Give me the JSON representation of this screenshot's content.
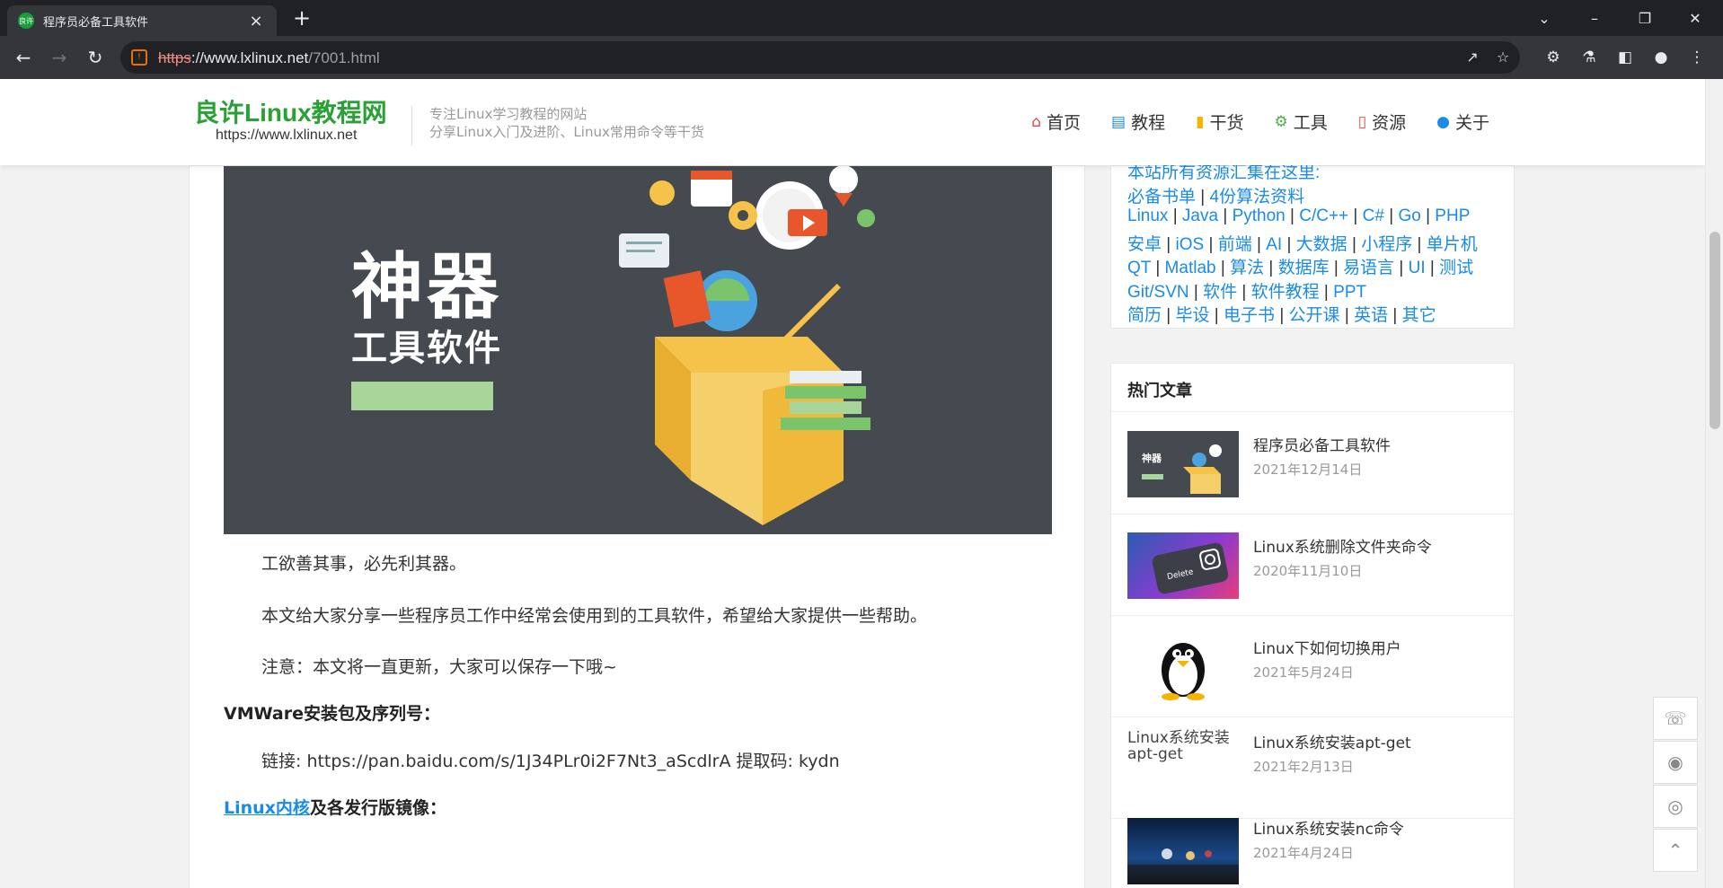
{
  "browser": {
    "tab_title": "程序员必备工具软件",
    "favicon_text": "良许",
    "new_tab": "+",
    "tab_close": "×",
    "url_scheme": "https",
    "url_sep": "://",
    "url_host": "www.lxlinux.net",
    "url_path": "/7001.html",
    "icons": {
      "back": "arrow-left-icon",
      "forward": "arrow-right-icon",
      "reload": "reload-icon",
      "share": "share-icon",
      "star": "star-icon",
      "extensions": "puzzle-icon",
      "labs": "flask-icon",
      "sidepanel": "side-panel-icon",
      "profile": "profile-icon",
      "menu": "kebab-menu-icon"
    }
  },
  "header": {
    "logo_title": "良许Linux教程网",
    "logo_url": "https://www.lxlinux.net",
    "slogan_1": "专注Linux学习教程的网站",
    "slogan_2": "分享Linux入门及进阶、Linux常用命令等干货",
    "nav": [
      {
        "label": "首页",
        "icon": "home-icon",
        "color": "#e8453c"
      },
      {
        "label": "教程",
        "icon": "book-icon",
        "color": "#1a8be8"
      },
      {
        "label": "干货",
        "icon": "bookmark-icon",
        "color": "#f5b400"
      },
      {
        "label": "工具",
        "icon": "cogs-icon",
        "color": "#4caf50"
      },
      {
        "label": "资源",
        "icon": "folder-open-icon",
        "color": "#e8453c"
      },
      {
        "label": "关于",
        "icon": "user-icon",
        "color": "#1a8be8"
      }
    ]
  },
  "article": {
    "hero_big": "神器",
    "hero_sub": "工具软件",
    "p1": "工欲善其事，必先利其器。",
    "p2": "本文给大家分享一些程序员工作中经常会使用到的工具软件，希望给大家提供一些帮助。",
    "p3": "注意：本文将一直更新，大家可以保存一下哦~",
    "h1": "VMWare安装包及序列号：",
    "link_line": "链接: https://pan.baidu.com/s/1J34PLr0i2F7Nt3_aScdlrA  提取码: kydn",
    "h2_link": "Linux内核",
    "h2_rest": "及各发行版镜像："
  },
  "resources": {
    "intro": "本站所有资源汇集在这里:",
    "lines": [
      [
        "必备书单",
        "4份算法资料"
      ],
      [
        "Linux",
        "Java",
        "Python",
        "C/C++",
        "C#",
        "Go",
        "PHP"
      ],
      [
        "安卓",
        "iOS",
        "前端",
        "AI",
        "大数据",
        "小程序",
        "单片机"
      ],
      [
        "QT",
        "Matlab",
        "算法",
        "数据库",
        "易语言",
        "UI",
        "测试"
      ],
      [
        "Git/SVN",
        "软件",
        "软件教程",
        "PPT"
      ],
      [
        "简历",
        "毕设",
        "电子书",
        "公开课",
        "英语",
        "其它"
      ]
    ],
    "separator": " | "
  },
  "hot": {
    "heading": "热门文章",
    "items": [
      {
        "title": "程序员必备工具软件",
        "date": "2021年12月14日",
        "thumb": "tools"
      },
      {
        "title": "Linux系统删除文件夹命令",
        "date": "2020年11月10日",
        "thumb": "keyboard"
      },
      {
        "title": "Linux下如何切换用户",
        "date": "2021年5月24日",
        "thumb": "penguin"
      },
      {
        "title": "Linux系统安装apt-get",
        "date": "2021年2月13日",
        "thumb": "broken",
        "alt": "Linux系统安装apt-get"
      },
      {
        "title": "Linux系统安装nc命令",
        "date": "2021年4月24日",
        "thumb": "lights"
      }
    ]
  },
  "float_tools": [
    "phone-icon",
    "wechat-icon",
    "weibo-icon",
    "back-to-top-icon"
  ]
}
